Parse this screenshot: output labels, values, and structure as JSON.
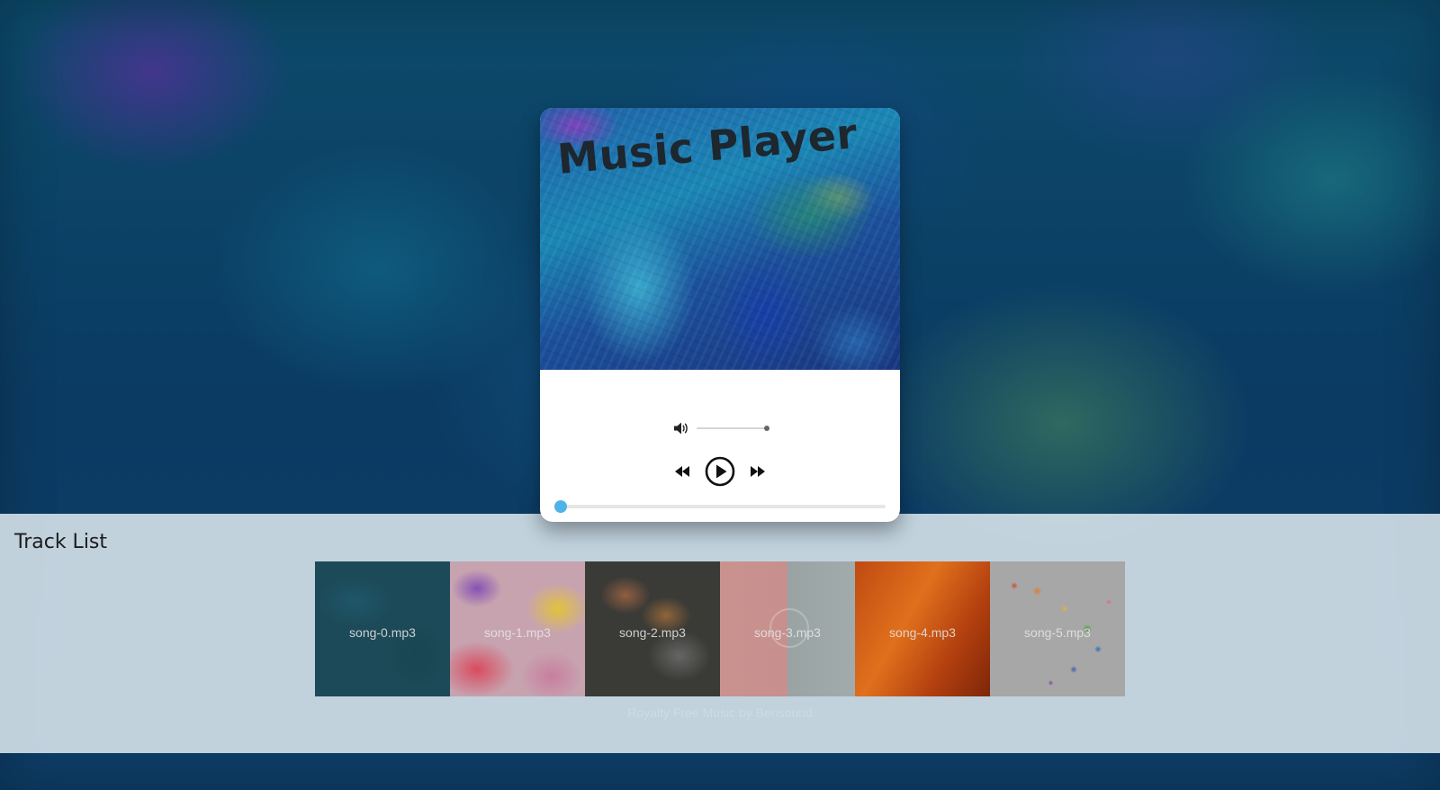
{
  "player": {
    "title": "Music Player",
    "volume_level": 1.0,
    "progress": 0.0,
    "accent_color": "#4fb3e8",
    "icons": {
      "volume": "volume-icon",
      "previous": "rewind-icon",
      "play": "play-circle-icon",
      "next": "fast-forward-icon"
    }
  },
  "tracklist": {
    "heading": "Track List",
    "tracks": [
      {
        "name": "song-0.mp3"
      },
      {
        "name": "song-1.mp3"
      },
      {
        "name": "song-2.mp3"
      },
      {
        "name": "song-3.mp3"
      },
      {
        "name": "song-4.mp3"
      },
      {
        "name": "song-5.mp3"
      }
    ]
  },
  "footer": {
    "credit": "Royalty Free Music by Bensound"
  }
}
